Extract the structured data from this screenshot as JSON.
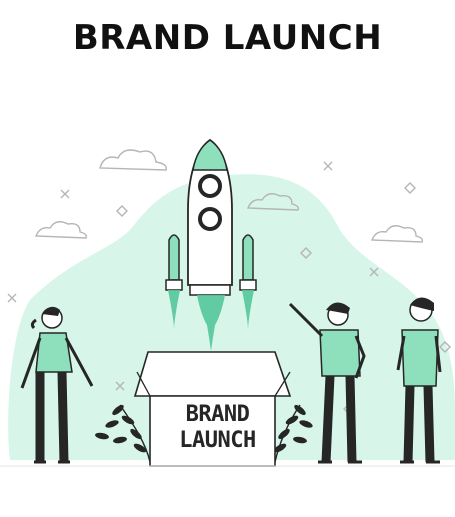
{
  "title": "BRAND LAUNCH",
  "box_text": {
    "line1": "BRAND",
    "line2": "LAUNCH"
  },
  "colors": {
    "accent": "#8ee0bd",
    "accent_dark": "#54c79b",
    "ink": "#262626",
    "background": "#ffffff"
  },
  "icons": [
    "cloud-icon",
    "sparkle-cross-icon",
    "diamond-icon",
    "rocket-icon",
    "leaf-branch-icon"
  ]
}
